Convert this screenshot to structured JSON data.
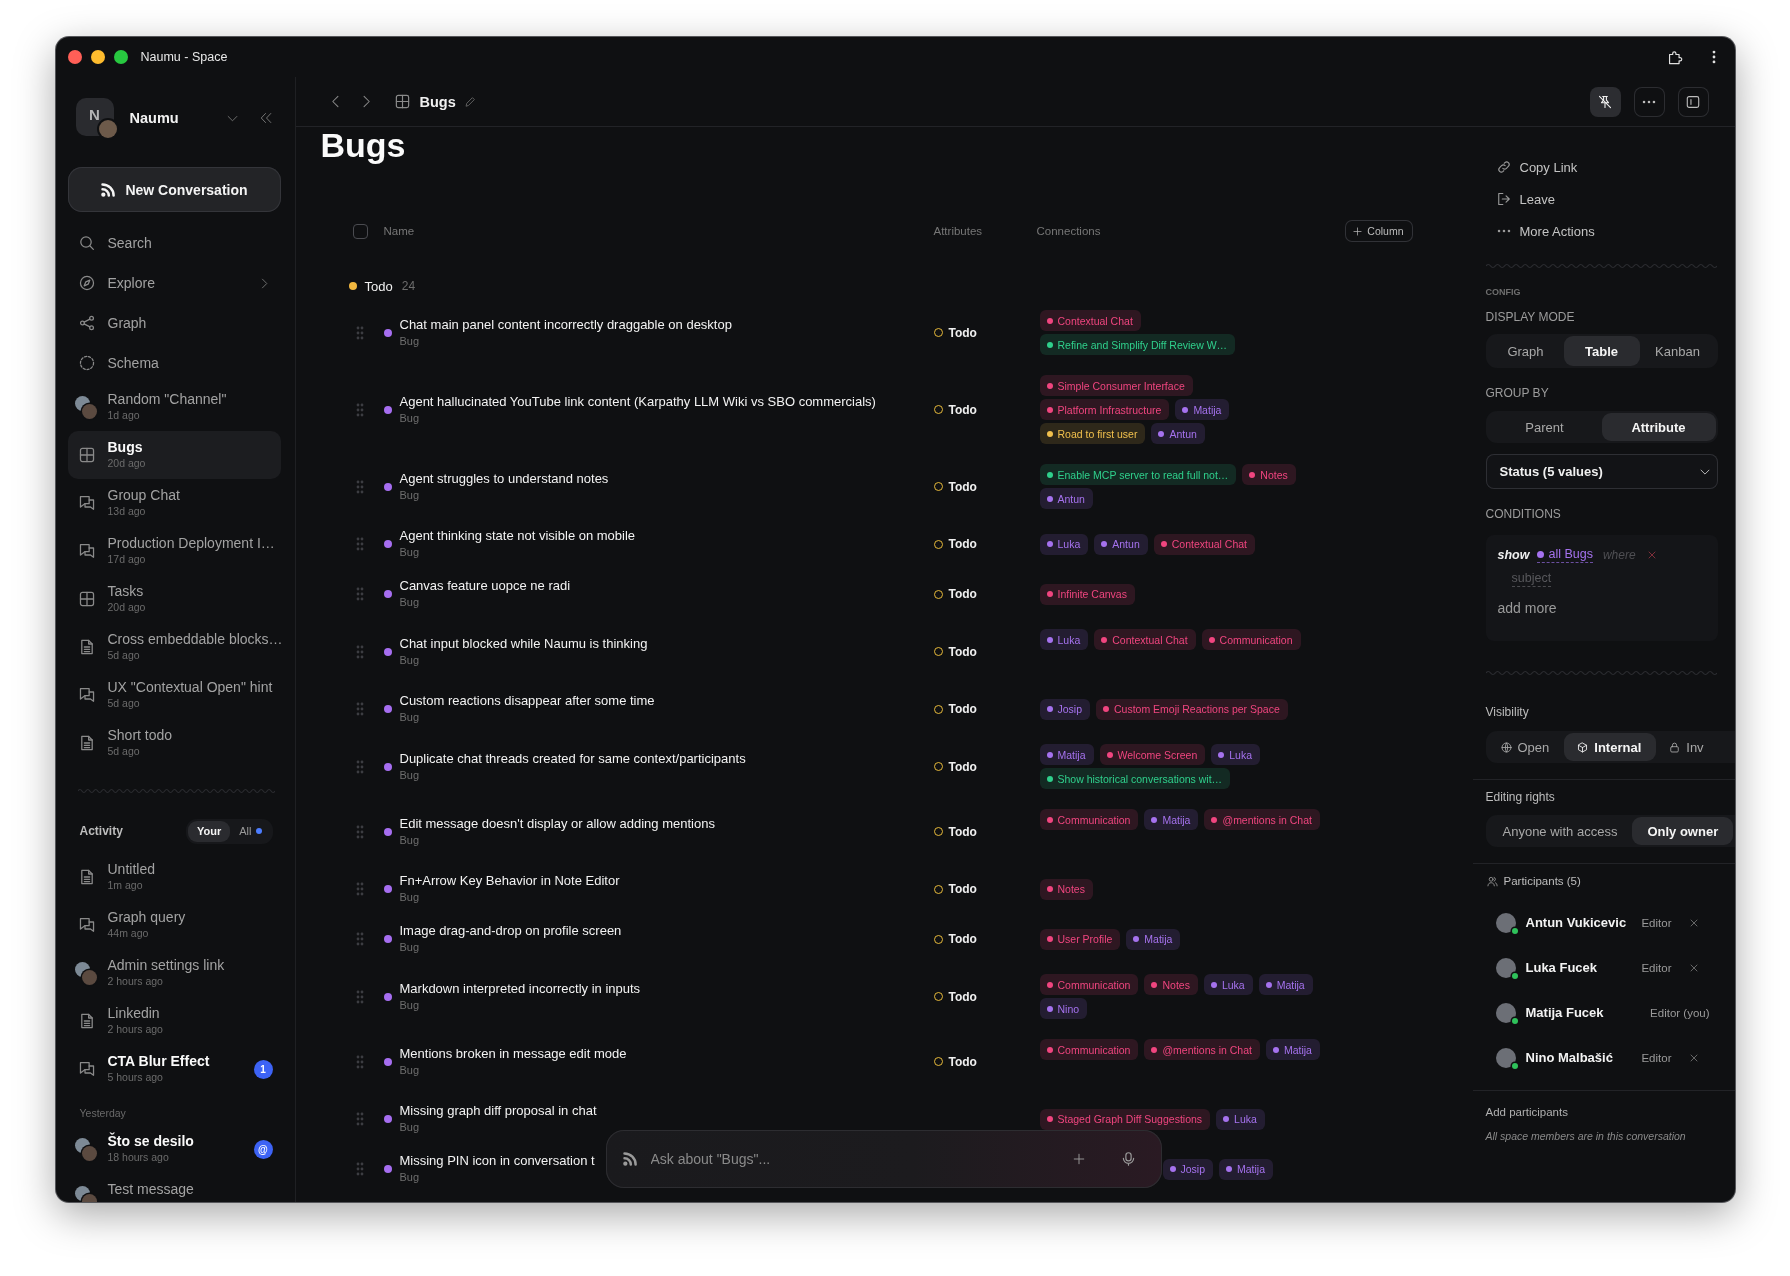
{
  "window": {
    "title": "Naumu - Space"
  },
  "sidebar": {
    "workspace": {
      "initial": "N",
      "name": "Naumu"
    },
    "new_conversation": "New Conversation",
    "nav": [
      {
        "label": "Search",
        "kind": "search",
        "selected": false
      },
      {
        "label": "Explore",
        "kind": "explore",
        "selected": false,
        "submenu": true
      },
      {
        "label": "Graph",
        "kind": "graph",
        "selected": false
      },
      {
        "label": "Schema",
        "kind": "schema",
        "selected": false
      }
    ],
    "conversations": [
      {
        "title": "Random \"Channel\"",
        "time": "1d ago",
        "kind": "channel",
        "selected": false
      },
      {
        "title": "Bugs",
        "time": "20d ago",
        "kind": "table",
        "selected": true
      },
      {
        "title": "Group Chat",
        "time": "13d ago",
        "kind": "chat",
        "selected": false
      },
      {
        "title": "Production Deployment I…",
        "time": "17d ago",
        "kind": "chat",
        "selected": false
      },
      {
        "title": "Tasks",
        "time": "20d ago",
        "kind": "table",
        "selected": false
      },
      {
        "title": "Cross embeddable blocks…",
        "time": "5d ago",
        "kind": "note",
        "selected": false
      },
      {
        "title": "UX \"Contextual Open\" hint",
        "time": "5d ago",
        "kind": "chat",
        "selected": false
      },
      {
        "title": "Short todo",
        "time": "5d ago",
        "kind": "note",
        "selected": false
      }
    ],
    "activity": {
      "title": "Activity",
      "filters": [
        {
          "label": "Your",
          "selected": true,
          "unread": false
        },
        {
          "label": "All",
          "selected": false,
          "unread": true
        }
      ],
      "sections": [
        {
          "items": [
            {
              "title": "Untitled",
              "time": "1m ago",
              "kind": "note",
              "unread": false,
              "selected": false
            },
            {
              "title": "Graph query",
              "time": "44m ago",
              "kind": "chat",
              "unread": false,
              "selected": false
            },
            {
              "title": "Admin settings link",
              "time": "2 hours ago",
              "kind": "channel",
              "unread": false,
              "selected": false
            },
            {
              "title": "Linkedin",
              "time": "2 hours ago",
              "kind": "note",
              "unread": false,
              "selected": false
            },
            {
              "title": "CTA Blur Effect",
              "time": "5 hours ago",
              "kind": "chat",
              "unread": true,
              "badge": "1",
              "selected": false
            }
          ]
        },
        {
          "heading": "Yesterday",
          "items": [
            {
              "title": "Što se desilo",
              "time": "18 hours ago",
              "kind": "channel",
              "unread": true,
              "badge": "@",
              "selected": false
            },
            {
              "title": "Test message",
              "kind": "channel",
              "unread": false,
              "selected": false
            }
          ]
        }
      ]
    }
  },
  "toolbar": {
    "title": "Bugs",
    "pin_active": true
  },
  "page": {
    "title": "Bugs"
  },
  "table": {
    "select_all_checked": false,
    "columns": [
      "Name",
      "Attributes",
      "Connections"
    ],
    "add_column": "Column",
    "groups": [
      {
        "label": "Todo",
        "count": "24",
        "rows": [
          {
            "title": "Chat main panel content incorrectly draggable on desktop",
            "type": "Bug",
            "status": "Todo",
            "connections": [
              {
                "label": "Contextual Chat",
                "color": "#f0457f"
              },
              {
                "label": "Refine and Simplify Diff Review W…",
                "color": "#2fd08c"
              }
            ]
          },
          {
            "title": "Agent hallucinated YouTube link content (Karpathy LLM Wiki vs SBO commercials)",
            "type": "Bug",
            "status": "Todo",
            "connections": [
              {
                "label": "Simple Consumer Interface",
                "color": "#f0457f"
              },
              {
                "label": "Platform Infrastructure",
                "color": "#f0457f"
              },
              {
                "label": "Matija",
                "color": "#a572ee"
              },
              {
                "label": "Road to first user",
                "color": "#f1c04d"
              },
              {
                "label": "Antun",
                "color": "#a572ee"
              }
            ]
          },
          {
            "title": "Agent struggles to understand notes",
            "type": "Bug",
            "status": "Todo",
            "connections": [
              {
                "label": "Enable MCP server to read full not…",
                "color": "#2fd08c"
              },
              {
                "label": "Notes",
                "color": "#f0457f"
              },
              {
                "label": "Antun",
                "color": "#a572ee"
              }
            ]
          },
          {
            "title": "Agent thinking state not visible on mobile",
            "type": "Bug",
            "status": "Todo",
            "connections": [
              {
                "label": "Luka",
                "color": "#a572ee"
              },
              {
                "label": "Antun",
                "color": "#a572ee"
              },
              {
                "label": "Contextual Chat",
                "color": "#f0457f"
              }
            ]
          },
          {
            "title": "Canvas feature uopce ne radi",
            "type": "Bug",
            "status": "Todo",
            "connections": [
              {
                "label": "Infinite Canvas",
                "color": "#f0457f"
              }
            ]
          },
          {
            "title": "Chat input blocked while Naumu is thinking",
            "type": "Bug",
            "status": "Todo",
            "connections": [
              {
                "label": "Luka",
                "color": "#a572ee"
              },
              {
                "label": "Contextual Chat",
                "color": "#f0457f"
              },
              {
                "label": "Communication",
                "color": "#f0457f"
              }
            ]
          },
          {
            "title": "Custom reactions disappear after some time",
            "type": "Bug",
            "status": "Todo",
            "connections": [
              {
                "label": "Josip",
                "color": "#a572ee"
              },
              {
                "label": "Custom Emoji Reactions per Space",
                "color": "#f0457f"
              }
            ]
          },
          {
            "title": "Duplicate chat threads created for same context/participants",
            "type": "Bug",
            "status": "Todo",
            "connections": [
              {
                "label": "Matija",
                "color": "#a572ee"
              },
              {
                "label": "Welcome Screen",
                "color": "#f0457f"
              },
              {
                "label": "Luka",
                "color": "#a572ee"
              },
              {
                "label": "Show historical conversations wit…",
                "color": "#2fd08c"
              }
            ]
          },
          {
            "title": "Edit message doesn't display or allow adding mentions",
            "type": "Bug",
            "status": "Todo",
            "connections": [
              {
                "label": "Communication",
                "color": "#f0457f"
              },
              {
                "label": "Matija",
                "color": "#a572ee"
              },
              {
                "label": "@mentions in Chat",
                "color": "#f0457f"
              }
            ]
          },
          {
            "title": "Fn+Arrow Key Behavior in Note Editor",
            "type": "Bug",
            "status": "Todo",
            "connections": [
              {
                "label": "Notes",
                "color": "#f0457f"
              }
            ]
          },
          {
            "title": "Image drag-and-drop on profile screen",
            "type": "Bug",
            "status": "Todo",
            "connections": [
              {
                "label": "User Profile",
                "color": "#f0457f"
              },
              {
                "label": "Matija",
                "color": "#a572ee"
              }
            ]
          },
          {
            "title": "Markdown interpreted incorrectly in inputs",
            "type": "Bug",
            "status": "Todo",
            "connections": [
              {
                "label": "Communication",
                "color": "#f0457f"
              },
              {
                "label": "Notes",
                "color": "#f0457f"
              },
              {
                "label": "Luka",
                "color": "#a572ee"
              },
              {
                "label": "Matija",
                "color": "#a572ee"
              },
              {
                "label": "Nino",
                "color": "#a572ee"
              }
            ]
          },
          {
            "title": "Mentions broken in message edit mode",
            "type": "Bug",
            "status": "Todo",
            "connections": [
              {
                "label": "Communication",
                "color": "#f0457f"
              },
              {
                "label": "@mentions in Chat",
                "color": "#f0457f"
              },
              {
                "label": "Matija",
                "color": "#a572ee"
              }
            ]
          },
          {
            "title": "Missing graph diff proposal in chat",
            "type": "Bug",
            "connections": [
              {
                "label": "Staged Graph Diff Suggestions",
                "color": "#f0457f"
              },
              {
                "label": "Luka",
                "color": "#a572ee"
              }
            ]
          },
          {
            "title": "Missing PIN icon in conversation t",
            "type": "Bug",
            "connections": [
              {
                "label": "Josip",
                "color": "#a572ee"
              },
              {
                "label": "Matija",
                "color": "#a572ee"
              }
            ]
          }
        ]
      }
    ]
  },
  "composer": {
    "placeholder": "Ask about \"Bugs\"..."
  },
  "panel": {
    "actions": [
      {
        "label": "Copy Link",
        "kind": "link"
      },
      {
        "label": "Leave",
        "kind": "leave"
      },
      {
        "label": "More Actions",
        "kind": "more"
      }
    ],
    "config": {
      "heading": "CONFIG",
      "display_mode": {
        "label": "DISPLAY MODE",
        "options": [
          {
            "label": "Graph",
            "selected": false
          },
          {
            "label": "Table",
            "selected": true
          },
          {
            "label": "Kanban",
            "selected": false
          }
        ]
      },
      "group_by": {
        "label": "GROUP BY",
        "options": [
          {
            "label": "Parent",
            "selected": false
          },
          {
            "label": "Attribute",
            "selected": true
          }
        ],
        "field": "Status (5 values)"
      },
      "conditions": {
        "label": "CONDITIONS",
        "keyword": "show",
        "subject": "all Bugs",
        "joiner": "where",
        "field": "subject",
        "add_more": "add more"
      }
    },
    "visibility": {
      "label": "Visibility",
      "options": [
        {
          "label": "Open",
          "kind": "open",
          "selected": false
        },
        {
          "label": "Internal",
          "kind": "internal",
          "selected": true
        },
        {
          "label": "Inv",
          "kind": "locked",
          "selected": false
        }
      ]
    },
    "editing_rights": {
      "label": "Editing rights",
      "options": [
        {
          "label": "Anyone with access",
          "selected": false
        },
        {
          "label": "Only owner",
          "selected": true
        }
      ]
    },
    "participants": {
      "label": "Participants (5)",
      "people": [
        {
          "name": "Antun Vukicevic",
          "role": "Editor",
          "online": true,
          "removable": true
        },
        {
          "name": "Luka Fucek",
          "role": "Editor",
          "online": true,
          "removable": true
        },
        {
          "name": "Matija Fucek",
          "role": "Editor (you)",
          "online": true,
          "removable": false
        },
        {
          "name": "Nino Malbašić",
          "role": "Editor",
          "online": true,
          "removable": true
        }
      ],
      "add": "Add participants",
      "note": "All space members are in this conversation"
    }
  }
}
